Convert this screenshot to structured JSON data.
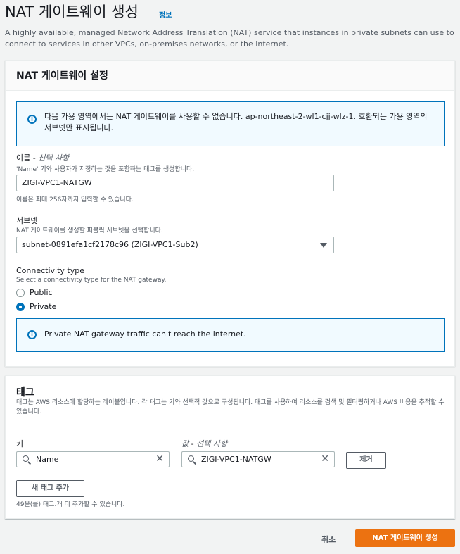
{
  "header": {
    "title": "NAT 게이트웨이 생성",
    "info_link": "정보",
    "description": "A highly available, managed Network Address Translation (NAT) service that instances in private subnets can use to connect to services in other VPCs, on-premises networks, or the internet."
  },
  "settings": {
    "title": "NAT 게이트웨이 설정",
    "availability_alert": "다음 가용 영역에서는 NAT 게이트웨이를 사용할 수 없습니다. ap-northeast-2-wl1-cjj-wlz-1. 호환되는 가용 영역의 서브넷만 표시됩니다.",
    "name": {
      "label": "이름",
      "optional": "선택 사항",
      "description": "'Name' 키와 사용자가 지정하는 값을 포함하는 태그를 생성합니다.",
      "value": "ZIGI-VPC1-NATGW",
      "hint": "이름은 최대 256자까지 입력할 수 있습니다."
    },
    "subnet": {
      "label": "서브넷",
      "description": "NAT 게이트웨이를 생성할 퍼블릭 서브넷을 선택합니다.",
      "selected": "subnet-0891efa1cf2178c96 (ZIGI-VPC1-Sub2)"
    },
    "connectivity": {
      "label": "Connectivity type",
      "description": "Select a connectivity type for the NAT gateway.",
      "options": [
        "Public",
        "Private"
      ],
      "selected": "Private"
    },
    "private_alert": "Private NAT gateway traffic can't reach the internet."
  },
  "tags": {
    "title": "태그",
    "description": "태그는 AWS 리소스에 할당하는 레이블입니다. 각 태그는 키와 선택적 값으로 구성됩니다. 태그를 사용하여 리소스를 검색 및 필터링하거나 AWS 비용을 추적할 수 있습니다.",
    "key_label": "키",
    "value_label": "값",
    "value_optional": "선택 사항",
    "key_value": "Name",
    "value_value": "ZIGI-VPC1-NATGW",
    "remove_button": "제거",
    "add_button": "새 태그 추가",
    "remaining_hint": "49을(를) 태그.개 더 추가할 수 있습니다."
  },
  "footer": {
    "cancel": "취소",
    "create": "NAT 게이트웨이 생성"
  },
  "colors": {
    "accent": "#0073bb",
    "primary_button": "#ec7211"
  }
}
